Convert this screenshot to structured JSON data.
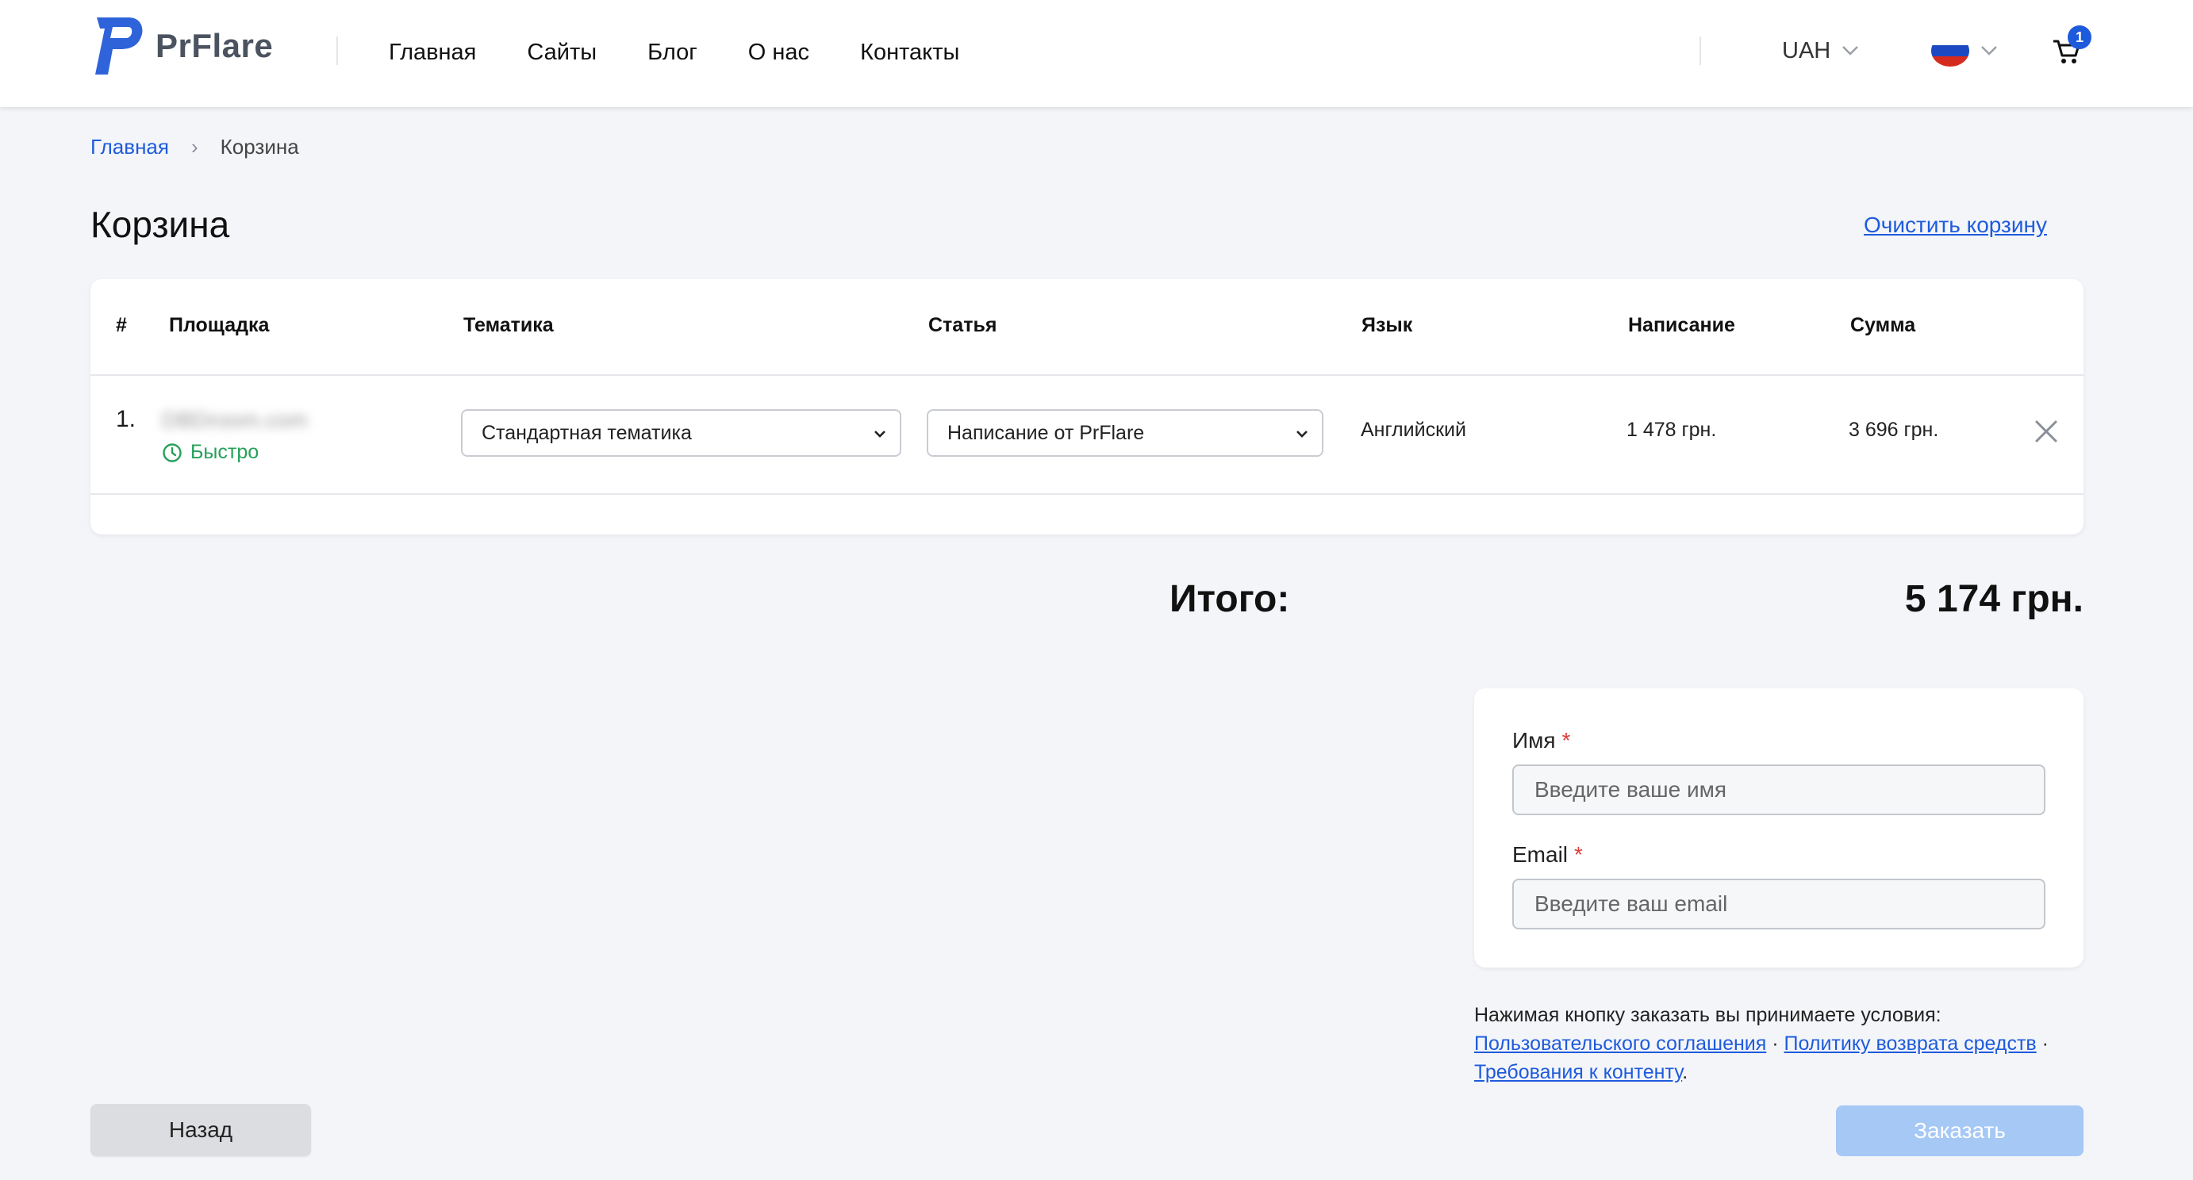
{
  "app": {
    "logo_text": "PrFlare",
    "brand_color": "#1e5bdc"
  },
  "nav": {
    "items": [
      "Главная",
      "Сайты",
      "Блог",
      "О нас",
      "Контакты"
    ]
  },
  "header": {
    "currency": "UAH",
    "language_flag": "ru-flag-icon",
    "cart_count": "1"
  },
  "breadcrumb": {
    "home": "Главная",
    "separator": "›",
    "current": "Корзина"
  },
  "page": {
    "title": "Корзина",
    "clear_cart": "Очистить корзину"
  },
  "table": {
    "headers": [
      "#",
      "Площадка",
      "Тематика",
      "Статья",
      "Язык",
      "Написание",
      "Сумма"
    ],
    "rows": [
      {
        "num": "1.",
        "site": "DBDroom.com",
        "speed": "Быстро",
        "topic": "Стандартная тематика",
        "article": "Написание от PrFlare",
        "language": "Английский",
        "writing": "1 478 грн.",
        "sum": "3 696 грн."
      }
    ]
  },
  "total": {
    "label": "Итого:",
    "value": "5 174 грн."
  },
  "form": {
    "name_label": "Имя",
    "name_placeholder": "Введите ваше имя",
    "email_label": "Email",
    "email_placeholder": "Введите ваш email",
    "required_mark": "*"
  },
  "terms": {
    "text": "Нажимая кнопку заказать вы принимаете условия:",
    "link1": "Пользовательского соглашения",
    "dot": "·",
    "link2": "Политику возврата средств",
    "link3": "Требования к контенту",
    "end": "."
  },
  "buttons": {
    "back": "Назад",
    "order": "Заказать"
  }
}
